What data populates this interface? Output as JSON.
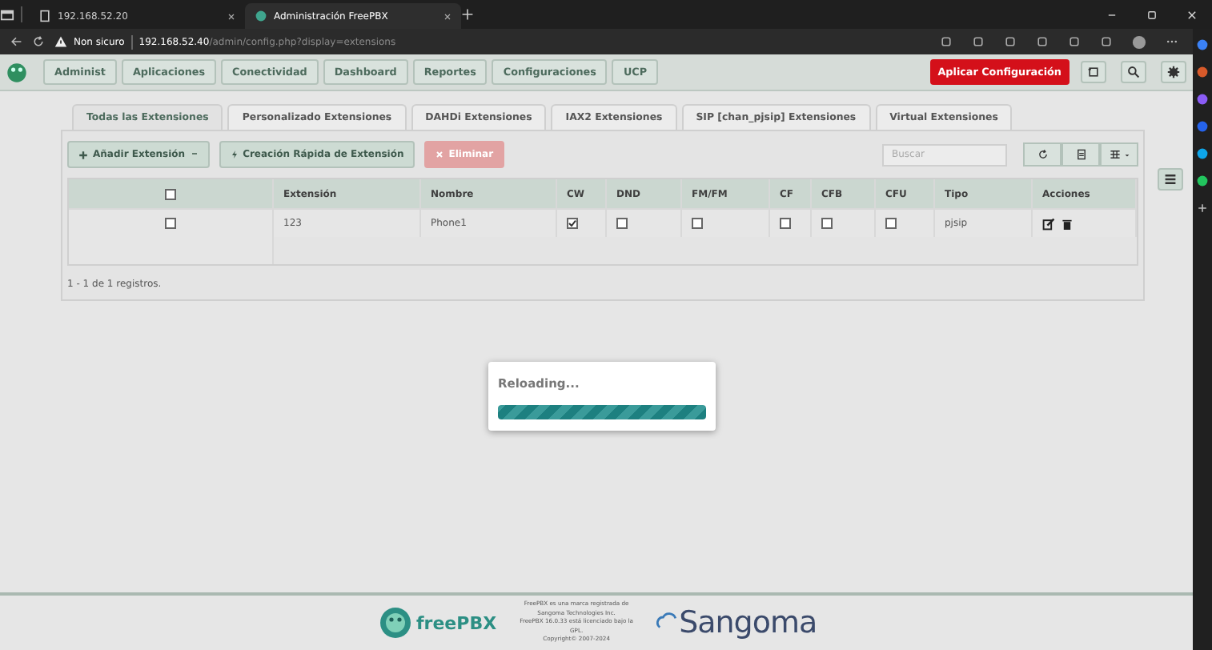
{
  "browser": {
    "tabs": [
      {
        "title": "192.168.52.20",
        "selected": false
      },
      {
        "title": "Administración FreePBX",
        "selected": true
      }
    ],
    "security_label": "Non sicuro",
    "url_host": "192.168.52.40",
    "url_path": "/admin/config.php?display=extensions"
  },
  "nav": {
    "items": [
      "Administ",
      "Aplicaciones",
      "Conectividad",
      "Dashboard",
      "Reportes",
      "Configuraciones",
      "UCP"
    ],
    "apply_button": "Aplicar Configuración"
  },
  "tabs": [
    {
      "label": "Todas las Extensiones",
      "selected": true
    },
    {
      "label": "Personalizado Extensiones",
      "selected": false
    },
    {
      "label": "DAHDi Extensiones",
      "selected": false
    },
    {
      "label": "IAX2 Extensiones",
      "selected": false
    },
    {
      "label": "SIP [chan_pjsip] Extensiones",
      "selected": false
    },
    {
      "label": "Virtual Extensiones",
      "selected": false
    }
  ],
  "toolbar": {
    "add_button": "Añadir Extensión",
    "quick_create_button": "Creación Rápida de Extensión",
    "delete_button": {
      "label": "Eliminar",
      "disabled": true
    },
    "search": {
      "placeholder": "Buscar"
    }
  },
  "table": {
    "select_all": {
      "checked": false
    },
    "columns": [
      "Extensión",
      "Nombre",
      "CW",
      "DND",
      "FM/FM",
      "CF",
      "CFB",
      "CFU",
      "Tipo",
      "Acciones"
    ],
    "rows": [
      {
        "checked": false,
        "extension": "123",
        "name": "Phone1",
        "flags": [
          {
            "checked": true
          },
          {
            "checked": false
          },
          {
            "checked": false
          },
          {
            "checked": false
          },
          {
            "checked": false
          },
          {
            "checked": false
          }
        ],
        "type": "pjsip"
      }
    ]
  },
  "pagination": "1 - 1 de 1 registros.",
  "modal": {
    "title": "Reloading...",
    "level": 1
  },
  "footer": {
    "brand": "freePBX",
    "legal": [
      "FreePBX es una marca registrada de",
      "Sangoma Technologies Inc.",
      "FreePBX 16.0.33 está licenciado bajo la",
      "GPL.",
      "Copyright© 2007-2024"
    ],
    "partner": "Sangoma"
  }
}
